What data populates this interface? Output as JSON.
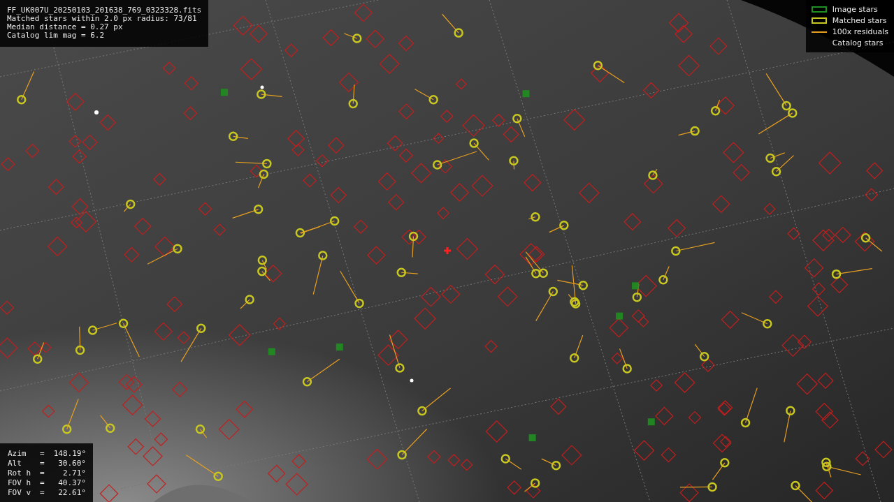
{
  "info": {
    "lines": [
      "FF_UK007U_20250103_201638_769_0323328.fits",
      "Matched stars within 2.0 px radius: 73/81",
      "Median distance = 0.27 px",
      "Catalog lim mag = 6.2"
    ]
  },
  "legend": [
    {
      "kind": "box",
      "color": "#1f8f1f",
      "label": "Image stars"
    },
    {
      "kind": "box",
      "color": "#c8c820",
      "label": "Matched stars"
    },
    {
      "kind": "line",
      "color": "#e8a020",
      "label": "100x residuals"
    },
    {
      "kind": "none",
      "label": "Catalog stars"
    }
  ],
  "pointing": [
    {
      "label": "Azim",
      "sep": "=",
      "value": "148.19°"
    },
    {
      "label": "Alt",
      "sep": "=",
      "value": "30.60°"
    },
    {
      "label": "Rot h",
      "sep": "=",
      "value": "2.71°"
    },
    {
      "label": "FOV h",
      "sep": "=",
      "value": "40.37°"
    },
    {
      "label": "FOV v",
      "sep": "=",
      "value": "22.61°"
    }
  ]
}
